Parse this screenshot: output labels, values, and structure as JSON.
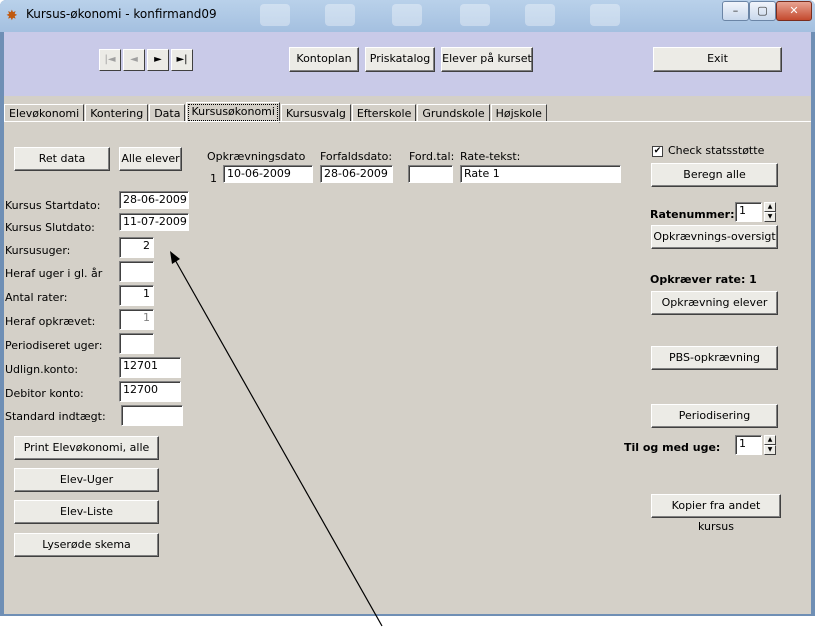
{
  "window": {
    "title": "Kursus-økonomi - konfirmand09",
    "controls": {
      "minimize": "–",
      "maximize": "▢",
      "close": "✕"
    }
  },
  "toolbar": {
    "nav": {
      "first": "|◄",
      "prev": "◄",
      "next": "►",
      "last": "►|"
    },
    "kontoplan": "Kontoplan",
    "priskatalog": "Priskatalog",
    "elever_paa_kurset": "Elever på kurset",
    "exit": "Exit"
  },
  "tabs": [
    {
      "label": "Elevøkonomi"
    },
    {
      "label": "Kontering"
    },
    {
      "label": "Data"
    },
    {
      "label": "Kursusøkonomi",
      "active": true
    },
    {
      "label": "Kursusvalg"
    },
    {
      "label": "Efterskole"
    },
    {
      "label": "Grundskole"
    },
    {
      "label": "Højskole"
    }
  ],
  "left": {
    "ret_data": "Ret data",
    "alle_elever": "Alle elever",
    "fields": {
      "kursus_startdato": {
        "label": "Kursus Startdato:",
        "value": "28-06-2009"
      },
      "kursus_slutdato": {
        "label": "Kursus Slutdato:",
        "value": "11-07-2009"
      },
      "kursusuger": {
        "label": "Kursusuger:",
        "value": "2"
      },
      "heraf_uger_gl_aar": {
        "label": "Heraf uger i gl. år",
        "value": ""
      },
      "antal_rater": {
        "label": "Antal rater:",
        "value": "1"
      },
      "heraf_opkraevet": {
        "label": "Heraf opkrævet:",
        "value": "1"
      },
      "periodiseret_uger": {
        "label": "Periodiseret uger:",
        "value": ""
      },
      "udlign_konto": {
        "label": "Udlign.konto:",
        "value": "12701"
      },
      "debitor_konto": {
        "label": "Debitor konto:",
        "value": "12700"
      },
      "standard_indtaegt": {
        "label": "Standard indtægt:",
        "value": ""
      }
    },
    "buttons": {
      "print_elevoekonomi": "Print Elevøkonomi, alle",
      "elev_uger": "Elev-Uger",
      "elev_liste": "Elev-Liste",
      "lyseroede": "Lyserøde skema"
    }
  },
  "rates": {
    "headers": {
      "opkraevningsdato": "Opkrævningsdato",
      "forfaldsdato": "Forfaldsdato:",
      "ford_tal": "Ford.tal:",
      "rate_tekst": "Rate-tekst:"
    },
    "rows": [
      {
        "nr": "1",
        "opkraevningsdato": "10-06-2009",
        "forfaldsdato": "28-06-2009",
        "ford_tal": "",
        "rate_tekst": "Rate 1"
      }
    ]
  },
  "right": {
    "check_statsstoette": {
      "label": "Check statsstøtte",
      "checked": true,
      "mark": "✔"
    },
    "beregn_alle": "Beregn alle",
    "ratenummer_label": "Ratenummer:",
    "ratenummer_value": "1",
    "opkraevnings_oversigt": "Opkrævnings-oversigt",
    "opkraever_rate": "Opkræver rate: 1",
    "opkraevning_elever": "Opkrævning elever",
    "pbs_opkraevning": "PBS-opkrævning",
    "periodisering": "Periodisering",
    "til_og_med_uge_label": "Til og med uge:",
    "til_og_med_uge_value": "1",
    "kopier_fra_andet_kursus": "Kopier fra andet kursus",
    "spin_up": "▲",
    "spin_down": "▼"
  }
}
